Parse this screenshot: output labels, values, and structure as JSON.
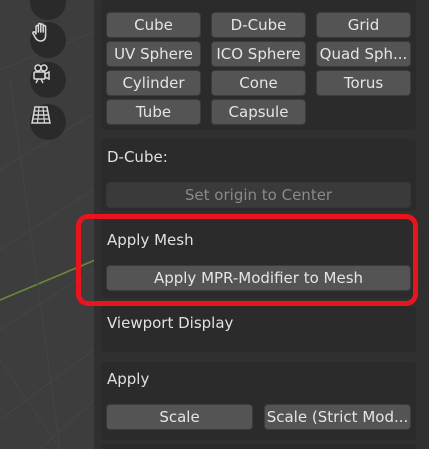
{
  "primitives": {
    "row1": [
      "Cube",
      "D-Cube",
      "Grid"
    ],
    "row2": [
      "UV Sphere",
      "ICO Sphere",
      "Quad Sph..."
    ],
    "row3": [
      "Cylinder",
      "Cone",
      "Torus"
    ],
    "row4": [
      "Tube",
      "Capsule"
    ]
  },
  "dcube": {
    "title": "D-Cube:",
    "set_origin_label": "Set origin to Center"
  },
  "apply_mesh": {
    "title": "Apply Mesh",
    "apply_button": "Apply MPR-Modifier to Mesh"
  },
  "viewport_display": {
    "title": "Viewport Display"
  },
  "apply": {
    "title": "Apply",
    "scale_button": "Scale",
    "scale_strict_button": "Scale (Strict Mod..."
  },
  "colors": {
    "highlight": "#e8141e",
    "button": "#545454",
    "panel": "#2b2b2b"
  },
  "toolbar": {
    "icons": [
      "magnifier-icon",
      "hand-icon",
      "camera-icon",
      "grid-icon"
    ]
  }
}
